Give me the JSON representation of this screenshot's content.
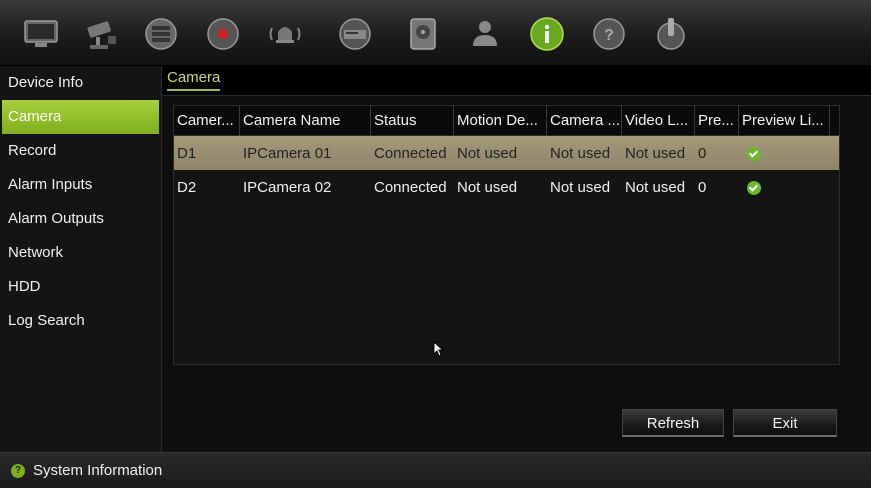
{
  "toolbar": {
    "icons": [
      {
        "name": "monitor-icon",
        "active": false
      },
      {
        "name": "camera-icon",
        "active": false
      },
      {
        "name": "network-icon",
        "active": false
      },
      {
        "name": "record-icon",
        "active": false
      },
      {
        "name": "alarm-icon",
        "active": false
      },
      {
        "name": "device-icon",
        "active": false
      },
      {
        "name": "hdd-icon",
        "active": false
      },
      {
        "name": "user-icon",
        "active": false
      },
      {
        "name": "info-icon",
        "active": true
      },
      {
        "name": "help-icon",
        "active": false
      },
      {
        "name": "power-icon",
        "active": false
      }
    ]
  },
  "sidebar": {
    "items": [
      {
        "label": "Device Info"
      },
      {
        "label": "Camera"
      },
      {
        "label": "Record"
      },
      {
        "label": "Alarm Inputs"
      },
      {
        "label": "Alarm Outputs"
      },
      {
        "label": "Network"
      },
      {
        "label": "HDD"
      },
      {
        "label": "Log Search"
      }
    ],
    "active_index": 1
  },
  "main": {
    "tab": "Camera",
    "table": {
      "columns": [
        "Camer...",
        "Camera Name",
        "Status",
        "Motion De...",
        "Camera ...",
        "Video L...",
        "Pre...",
        "Preview Li..."
      ],
      "rows": [
        {
          "camera": "D1",
          "name": "IPCamera 01",
          "status": "Connected",
          "motion": "Not used",
          "tamper": "Not used",
          "video_loss": "Not used",
          "pre": "0",
          "preview_icon": "check-icon",
          "selected": true
        },
        {
          "camera": "D2",
          "name": "IPCamera 02",
          "status": "Connected",
          "motion": "Not used",
          "tamper": "Not used",
          "video_loss": "Not used",
          "pre": "0",
          "preview_icon": "check-icon",
          "selected": false
        }
      ]
    },
    "buttons": {
      "refresh": "Refresh",
      "exit": "Exit"
    }
  },
  "statusbar": {
    "text": "System Information",
    "icon": "help-icon"
  },
  "colors": {
    "accent_green": "#8fbd24",
    "selected_row": "#9b8f72",
    "check_green": "#6ab82a"
  }
}
